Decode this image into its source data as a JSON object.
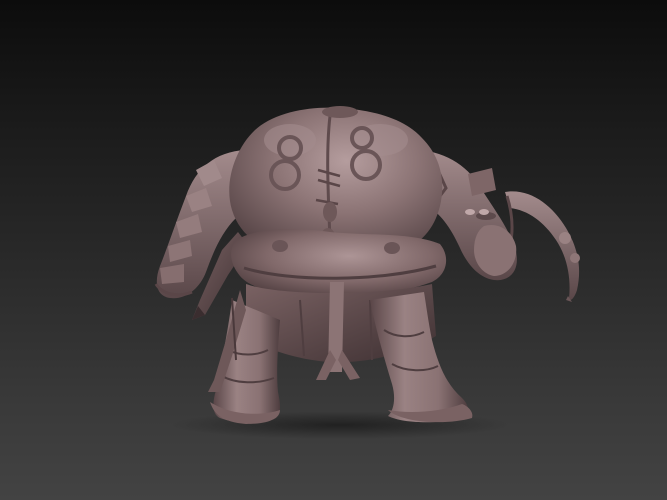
{
  "scene": {
    "model": "headless-orc-brute-sculpt",
    "background_top": "#0c0c0c",
    "background_bottom": "#434343",
    "clay_color": "#8a7274",
    "clay_highlight": "#b29a9b",
    "clay_shadow": "#4a3a3c"
  }
}
